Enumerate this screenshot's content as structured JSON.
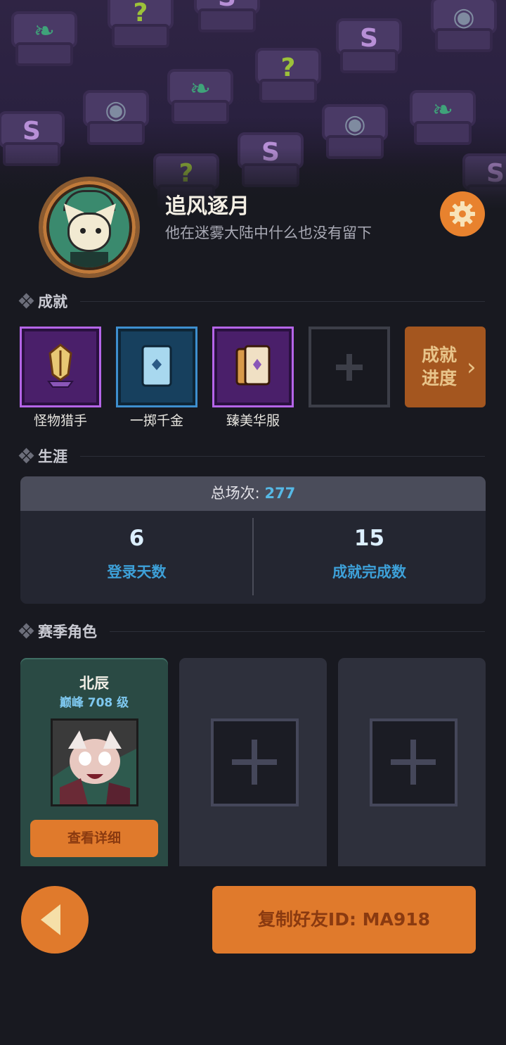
{
  "profile": {
    "nickname": "追风逐月",
    "signature": "他在迷雾大陆中什么也没有留下",
    "avatar_icon": "cat-avatar-icon"
  },
  "sections": {
    "achievements": "成就",
    "career": "生涯",
    "season_roles": "赛季角色"
  },
  "achievements": {
    "items": [
      {
        "label": "怪物猎手",
        "tier": "purple"
      },
      {
        "label": "一掷千金",
        "tier": "blue"
      },
      {
        "label": "臻美华服",
        "tier": "purple"
      }
    ],
    "progress_label_1": "成就",
    "progress_label_2": "进度",
    "progress_chevron": "›"
  },
  "career": {
    "total_label": "总场次: ",
    "total_value": "277",
    "stats": [
      {
        "value": "6",
        "label": "登录天数"
      },
      {
        "value": "15",
        "label": "成就完成数"
      }
    ]
  },
  "season_roles": {
    "active": {
      "name": "北辰",
      "level": "巅峰 708 级",
      "detail_button": "查看详细"
    },
    "empty_slots": 2
  },
  "bottom": {
    "copy_id_button": "复制好友ID: MA918"
  },
  "colors": {
    "accent": "#e07a2c",
    "highlight_blue": "#56b9e6",
    "panel": "#242631"
  }
}
